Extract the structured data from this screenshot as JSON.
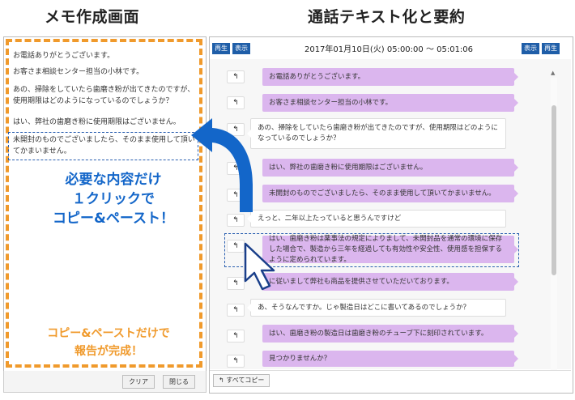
{
  "headings": {
    "left": "メモ作成画面",
    "right": "通話テキスト化と要約"
  },
  "memo": {
    "lines": [
      "お電話ありがとうございます。",
      "お客さま相談センター担当の小林です。",
      "あの、掃除をしていたら歯磨き粉が出てきたのですが、使用期限はどのようになっているのでしょうか？",
      "はい、弊社の歯磨き粉に使用期限はございません。",
      "未開封のものでございましたら、そのまま使用して頂いてかまいません。"
    ],
    "buttons": {
      "clear": "クリア",
      "close": "閉じる"
    },
    "callout": [
      "必要な内容だけ",
      "１クリックで",
      "コピー&ペースト！"
    ],
    "footer_callout": [
      "コピー&ペーストだけで",
      "報告が完成！"
    ],
    "colors": {
      "orange": "#f09a2c",
      "blue": "#1366c9"
    }
  },
  "transcript": {
    "title": "2017年01月10日(火) 05:00:00 〜 05:01:06",
    "left_buttons": [
      "再生",
      "表示"
    ],
    "right_buttons": [
      "表示",
      "再生"
    ],
    "reply_icon": "reply-arrow-icon",
    "messages": [
      {
        "speaker": "operator",
        "text": "お電話ありがとうございます。"
      },
      {
        "speaker": "operator",
        "text": "お客さま相談センター担当の小林です。"
      },
      {
        "speaker": "customer",
        "text": "あの、掃除をしていたら歯磨き粉が出てきたのですが、使用期限はどのようになっているのでしょうか？"
      },
      {
        "speaker": "operator",
        "text": "はい、弊社の歯磨き粉に使用期限はございません。"
      },
      {
        "speaker": "operator",
        "text": "未開封のものでございましたら、そのまま使用して頂いてかまいません。"
      },
      {
        "speaker": "customer",
        "text": "えっと、二年以上たっていると思うんですけど"
      },
      {
        "speaker": "operator",
        "text": "はい、歯磨き粉は薬事法の規定によりまして、未開封品を通常の環境に保存した場合で、製造から三年を経過しても有効性や安全性、使用感を担保するように定められています。"
      },
      {
        "speaker": "operator",
        "text": "に従いまして弊社も商品を提供させていただいております。"
      },
      {
        "speaker": "customer",
        "text": "あ、そうなんですか。じゃ製造日はどこに書いてあるのでしょうか？"
      },
      {
        "speaker": "operator",
        "text": "はい、歯磨き粉の製造日は歯磨き粉のチューブ下に刻印されています。"
      },
      {
        "speaker": "operator",
        "text": "見つかりませんか？"
      }
    ],
    "copy_all": "すべてコピー",
    "colors": {
      "operator_bubble": "#dbb6ee",
      "button": "#1f5ea8"
    }
  }
}
